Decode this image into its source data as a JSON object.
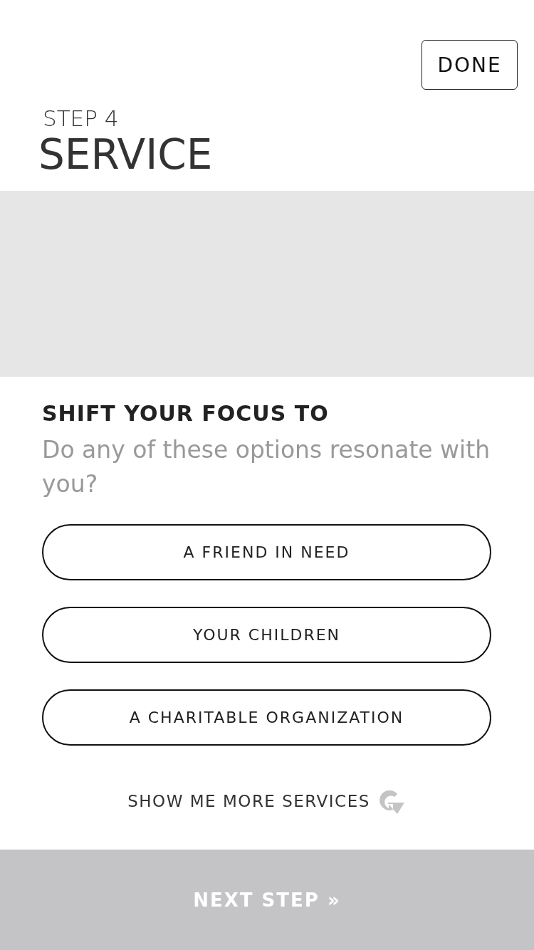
{
  "header": {
    "done_button": "DONE",
    "step": "STEP 4",
    "title": "SERVICE"
  },
  "hero": {
    "kind": "placeholder"
  },
  "prompt": {
    "heading": "SHIFT YOUR FOCUS TO",
    "question": "Do any of these options resonate with you?"
  },
  "options": [
    {
      "label": "A FRIEND IN NEED"
    },
    {
      "label": "YOUR CHILDREN"
    },
    {
      "label": "A CHARITABLE ORGANIZATION"
    }
  ],
  "more_link": "SHOW ME MORE SERVICES",
  "footer": {
    "next_button": "NEXT STEP »"
  }
}
